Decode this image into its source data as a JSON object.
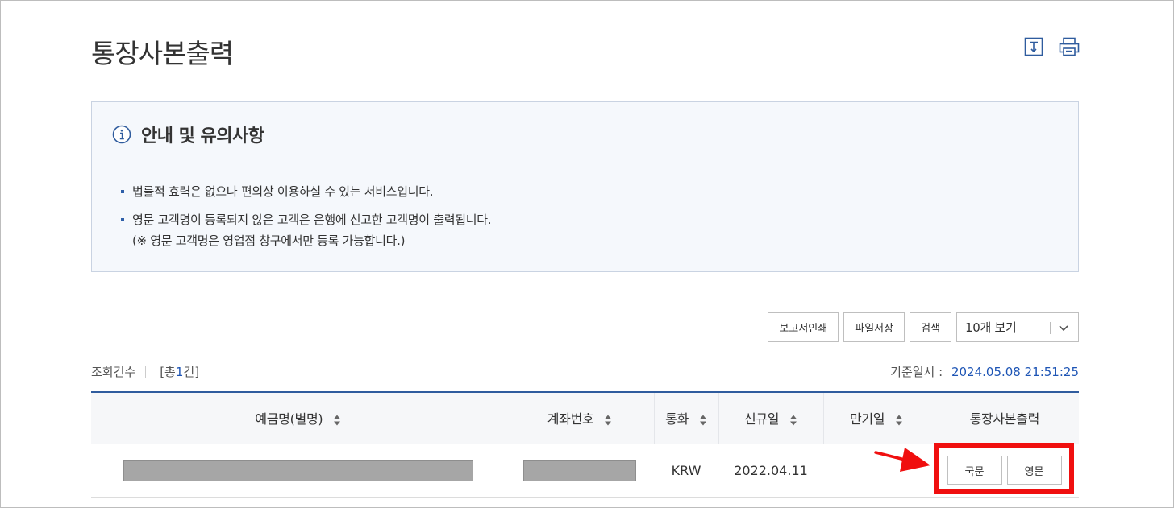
{
  "page": {
    "title": "통장사본출력"
  },
  "icons": {
    "download": "download-icon",
    "print": "print-icon",
    "info": "info-icon",
    "sort": "sort-icon",
    "chevron": "chevron-down-icon"
  },
  "notice": {
    "title": "안내 및 유의사항",
    "items": [
      {
        "line1": "법률적 효력은 없으나 편의상 이용하실 수 있는 서비스입니다.",
        "line2": ""
      },
      {
        "line1": "영문 고객명이 등록되지 않은 고객은 은행에 신고한 고객명이 출력됩니다.",
        "line2": "(※ 영문 고객명은 영업점 창구에서만 등록 가능합니다.)"
      }
    ]
  },
  "toolbar": {
    "print_report": "보고서인쇄",
    "save_file": "파일저장",
    "search": "검색",
    "page_size": "10개 보기"
  },
  "summary": {
    "count_label": "조회건수",
    "count_prefix": "[총 ",
    "count_value": "1",
    "count_suffix": "건]",
    "asof_label": "기준일시 :",
    "asof_value": "2024.05.08 21:51:25"
  },
  "table": {
    "columns": [
      "예금명(별명)",
      "계좌번호",
      "통화",
      "신규일",
      "만기일",
      "통장사본출력"
    ],
    "rows": [
      {
        "currency": "KRW",
        "open_date": "2022.04.11",
        "maturity": "",
        "btn_korean": "국문",
        "btn_english": "영문"
      }
    ]
  },
  "colors": {
    "accent": "#2f5c9e",
    "highlight": "#f00f0f",
    "link": "#1e55b5"
  }
}
